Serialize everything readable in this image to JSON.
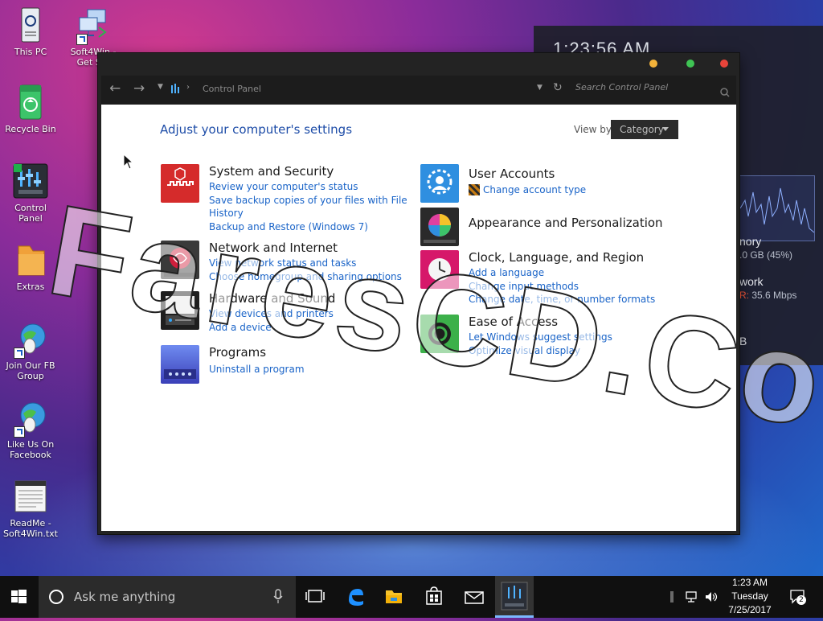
{
  "desktop": {
    "icons": [
      {
        "label_line1": "This PC",
        "label_line2": ""
      },
      {
        "label_line1": "Soft4Win -",
        "label_line2": "Get Sof"
      },
      {
        "label_line1": "Recycle Bin",
        "label_line2": ""
      },
      {
        "label_line1": "Control Panel",
        "label_line2": ""
      },
      {
        "label_line1": "Extras",
        "label_line2": ""
      },
      {
        "label_line1": "Join Our FB",
        "label_line2": "Group"
      },
      {
        "label_line1": "Like Us On",
        "label_line2": "Facebook"
      },
      {
        "label_line1": "ReadMe -",
        "label_line2": "Soft4Win.txt"
      }
    ]
  },
  "widget": {
    "time": "1:23:56 AM",
    "memory_label": "nory",
    "memory_value": ".0 GB (45%)",
    "network_label": "work",
    "network_r_prefix": "R:",
    "network_value": " 35.6 Mbps",
    "extra": "B"
  },
  "window": {
    "breadcrumb": "Control Panel",
    "search_placeholder": "Search Control Panel",
    "heading": "Adjust your computer's settings",
    "view_by_label": "View by:",
    "view_by_value": "Category",
    "categories_left": [
      {
        "title": "System and Security",
        "links": [
          "Review your computer's status",
          "Save backup copies of your files with File",
          "History",
          "Backup and Restore (Windows 7)"
        ]
      },
      {
        "title": "Network and Internet",
        "links": [
          "View network status and tasks",
          "Choose homegroup and sharing options"
        ]
      },
      {
        "title": "Hardware and Sound",
        "links": [
          "View devices and printers",
          "Add a device"
        ]
      },
      {
        "title": "Programs",
        "links": [
          "Uninstall a program"
        ]
      }
    ],
    "categories_right": [
      {
        "title": "User Accounts",
        "links": [
          "Change account type"
        ]
      },
      {
        "title": "Appearance and Personalization",
        "links": []
      },
      {
        "title": "Clock, Language, and Region",
        "links": [
          "Add a language",
          "Change input methods",
          "Change date, time, or number formats"
        ]
      },
      {
        "title": "Ease of Access",
        "links": [
          "Let Windows suggest settings",
          "Optimize visual display"
        ]
      }
    ]
  },
  "watermark": "FaresCD.Com",
  "taskbar": {
    "search_placeholder": "Ask me anything",
    "clock_time": "1:23 AM",
    "clock_day": "Tuesday",
    "clock_date": "7/25/2017",
    "notifications_count": "2"
  },
  "colors": {
    "accent": "#1e4da8",
    "link": "#1a64c8",
    "window_dark": "#232323",
    "taskbar": "#101010"
  }
}
